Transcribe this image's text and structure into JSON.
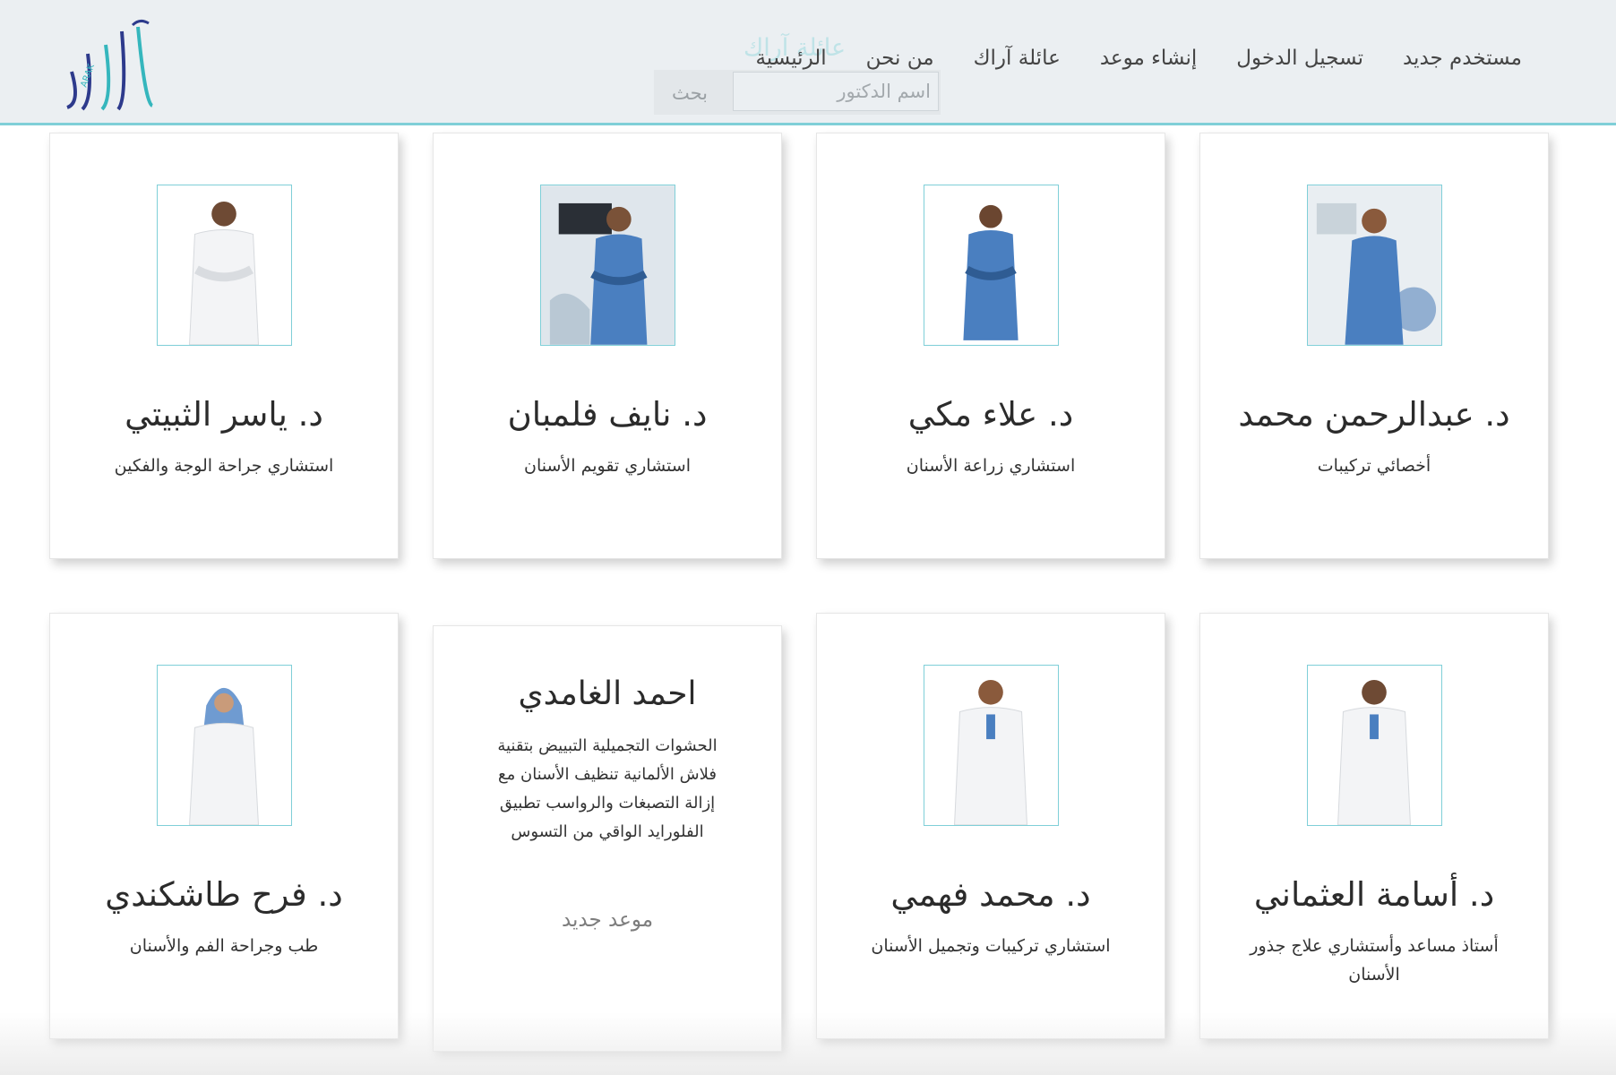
{
  "header": {
    "logo_text": "ARAK",
    "ghost_title": "عائلة آراك",
    "nav": [
      "الرئيسية",
      "من نحن",
      "عائلة آراك",
      "إنشاء موعد",
      "تسجيل الدخول",
      "مستخدم جديد"
    ],
    "search": {
      "button": "بحث",
      "placeholder": "اسم الدكتور"
    }
  },
  "colors": {
    "accent": "#7fcfd8",
    "header_bg": "#ebeff2",
    "logo_blue": "#2d3a8c",
    "logo_teal": "#35b6bd"
  },
  "doctors": [
    {
      "name": "د. عبدالرحمن محمد",
      "specialty": "أخصائي تركيبات",
      "photo": "doctor-blue-scrubs-icon"
    },
    {
      "name": "د. علاء مكي",
      "specialty": "استشاري زراعة الأسنان",
      "photo": "doctor-blue-scrubs-icon"
    },
    {
      "name": "د. نايف فلمبان",
      "specialty": "استشاري تقويم الأسنان",
      "photo": "doctor-blue-scrubs-icon"
    },
    {
      "name": "د. ياسر الثبيتي",
      "specialty": "استشاري جراحة الوجة والفكين",
      "photo": "doctor-white-coat-icon"
    },
    {
      "name": "د. أسامة العثماني",
      "specialty": "أستاذ مساعد وأستشاري علاج جذور الأسنان",
      "photo": "doctor-white-coat-icon"
    },
    {
      "name": "د. محمد فهمي",
      "specialty": "استشاري تركيبات وتجميل الأسنان",
      "photo": "doctor-white-coat-icon"
    },
    {
      "name": "د. فرح طاشكندي",
      "specialty": "طب وجراحة الفم والأسنان",
      "photo": "doctor-hijab-coat-icon"
    }
  ],
  "promo_card": {
    "name": "احمد الغامدي",
    "description": "الحشوات التجميلية التبييض بتقنية فلاش الألمانية تنظيف الأسنان مع إزالة التصبغات والرواسب تطبيق الفلورايد الواقي من التسوس",
    "link": "موعد جديد"
  }
}
